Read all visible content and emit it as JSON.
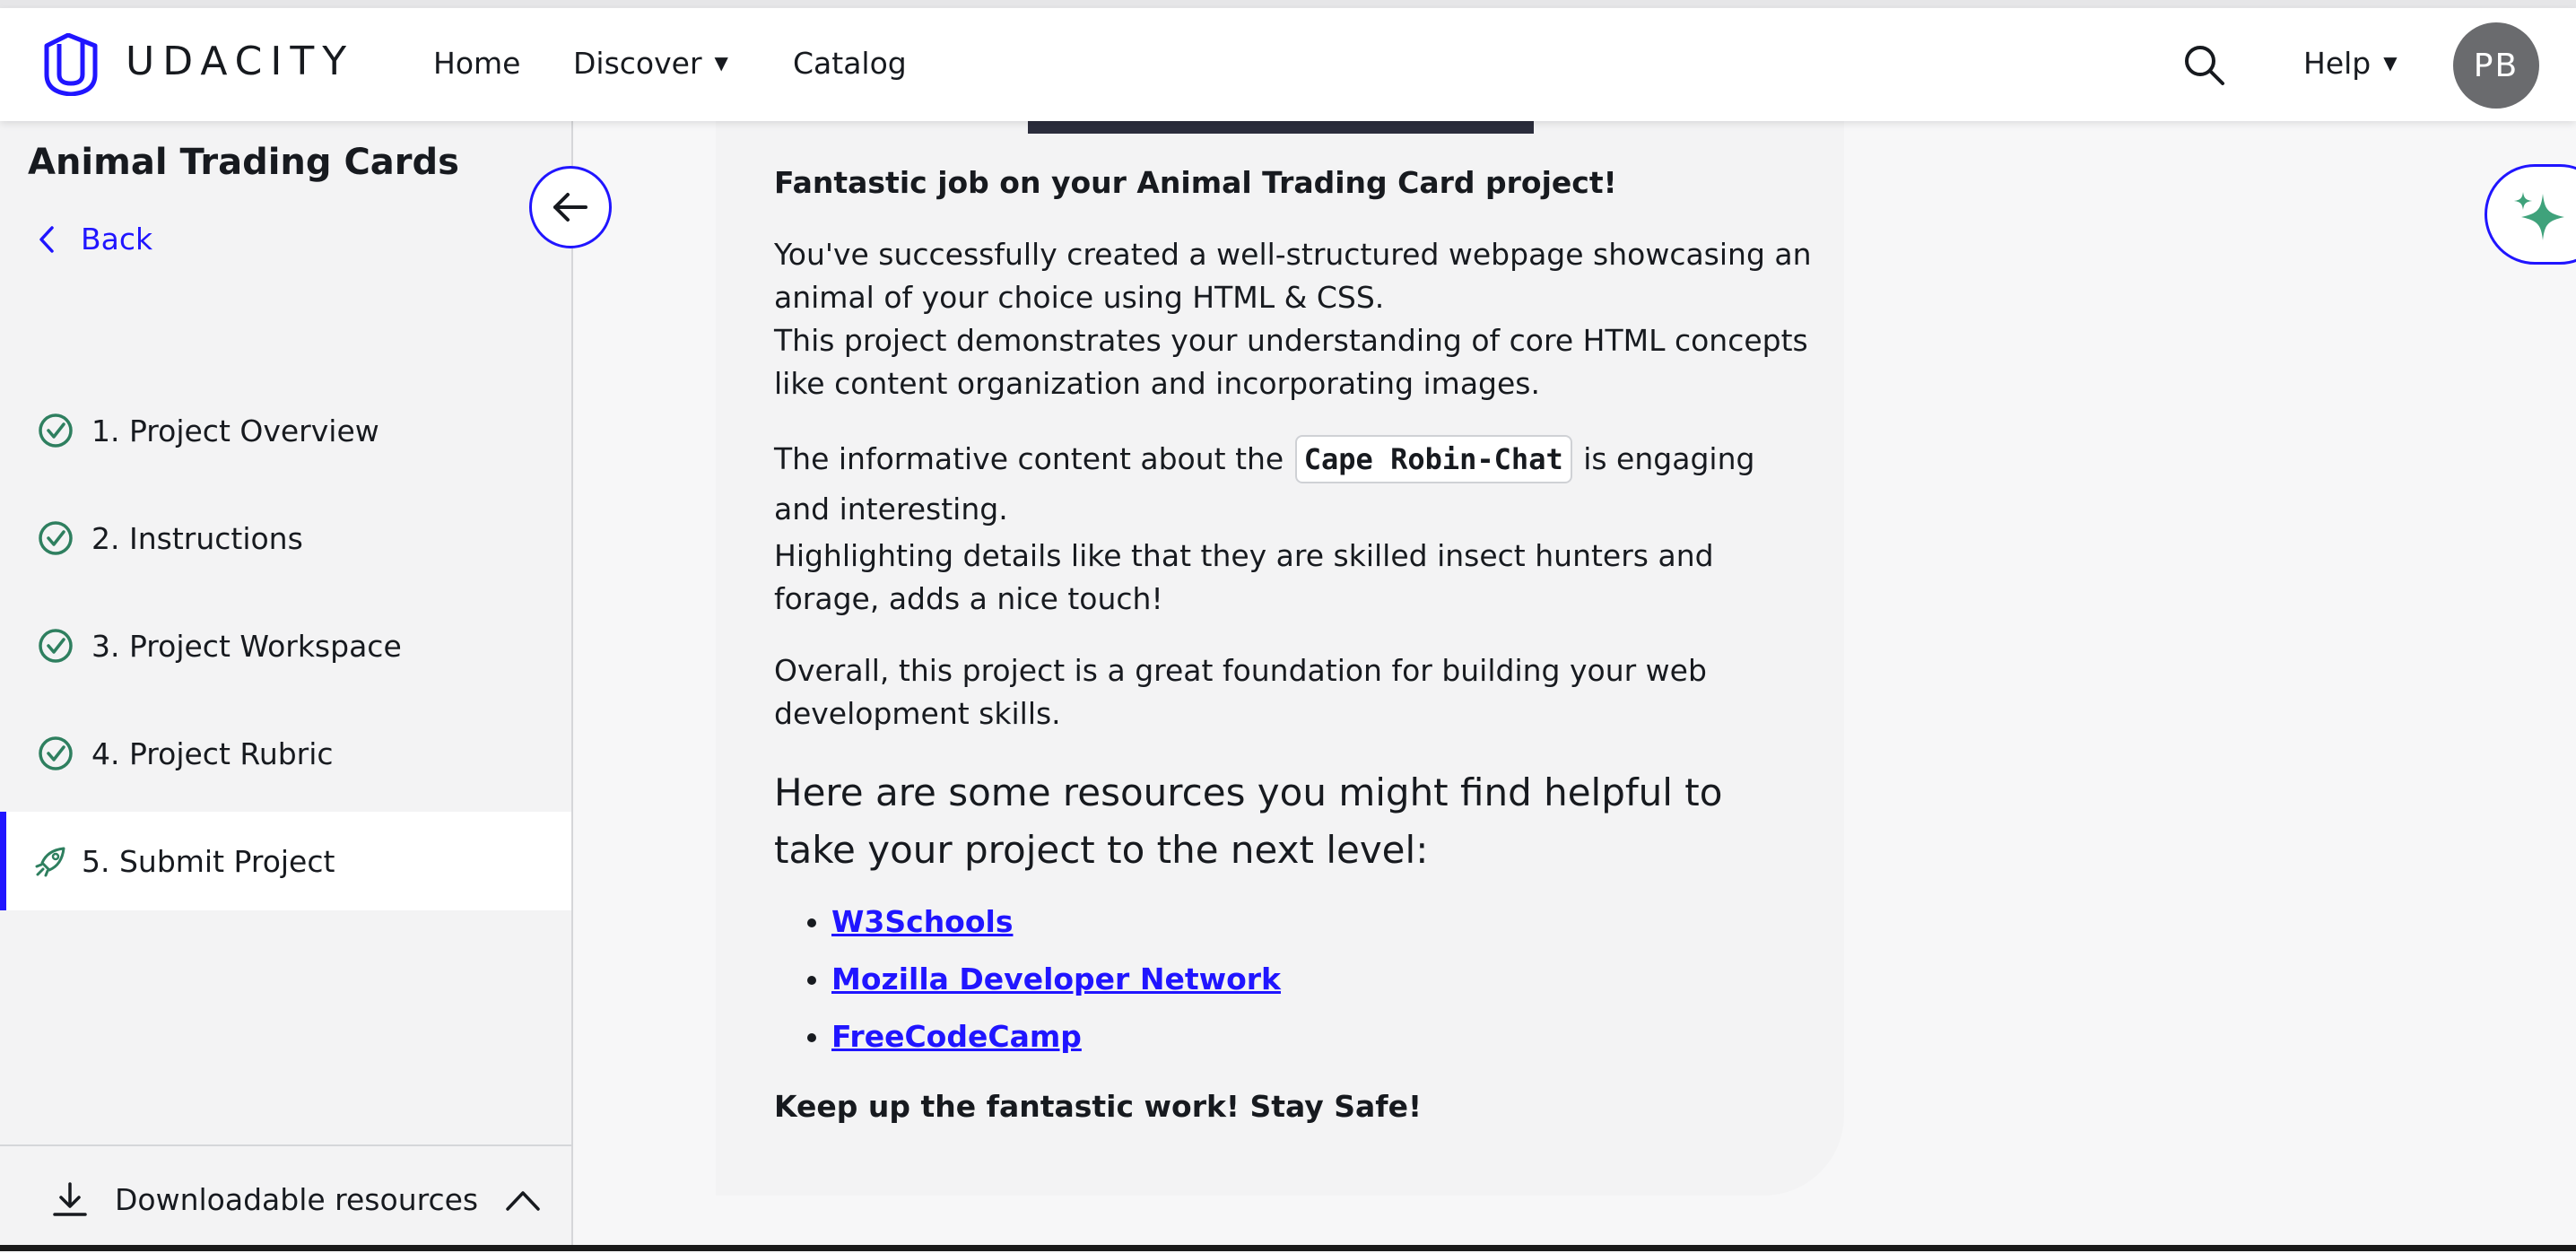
{
  "header": {
    "brand": "UDACITY",
    "nav": [
      "Home",
      "Discover",
      "Catalog"
    ],
    "help": "Help",
    "avatar_initials": "PB"
  },
  "sidebar": {
    "course_title": "Animal Trading Cards",
    "back_label": "Back",
    "steps": [
      {
        "label": "1. Project Overview",
        "status": "complete",
        "icon": "check-circle-icon"
      },
      {
        "label": "2. Instructions",
        "status": "complete",
        "icon": "check-circle-icon"
      },
      {
        "label": "3. Project Workspace",
        "status": "complete",
        "icon": "check-circle-icon"
      },
      {
        "label": "4. Project Rubric",
        "status": "complete",
        "icon": "check-circle-icon"
      },
      {
        "label": "5. Submit Project",
        "status": "active",
        "icon": "rocket-icon"
      }
    ],
    "downloads_label": "Downloadable resources"
  },
  "content": {
    "heading_strong": "Fantastic job on your Animal Trading Card project!",
    "para1_line1": "You've successfully created a well-structured webpage showcasing an animal of your choice using HTML & CSS.",
    "para1_line2": "This project demonstrates your understanding of core HTML concepts like content organization and incorporating images.",
    "para2_before": "The informative content about the ",
    "para2_code": "Cape Robin-Chat",
    "para2_after": " is engaging and interesting.",
    "para2_line2": "Highlighting details like that they are skilled insect hunters and forage, adds a nice touch!",
    "para3": "Overall, this project is a great foundation for building your web development skills.",
    "resources_heading": "Here are some resources you might find helpful to take your project to the next level:",
    "links": [
      "W3Schools",
      "Mozilla Developer Network",
      "FreeCodeCamp"
    ],
    "closing": "Keep up the fantastic work! Stay Safe!"
  },
  "colors": {
    "accent": "#2015ff",
    "check_green": "#2e7f5f",
    "sparkle_green": "#3fa27b"
  }
}
